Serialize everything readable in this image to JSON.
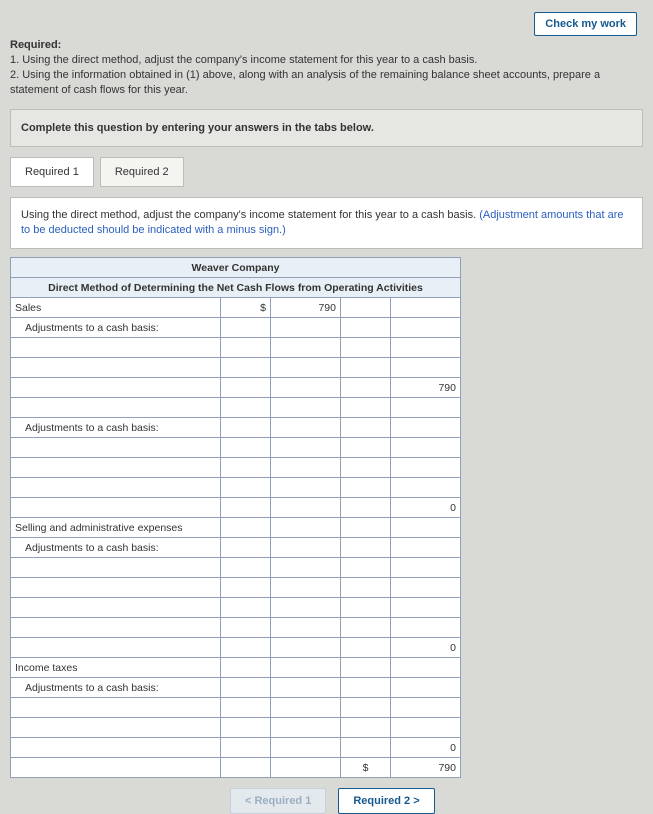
{
  "header": {
    "check_work": "Check my work"
  },
  "required": {
    "hdr": "Required:",
    "item1": "1. Using the direct method, adjust the company's income statement for this year to a cash basis.",
    "item2": "2. Using the information obtained in (1) above, along with an analysis of the remaining balance sheet accounts, prepare a statement of cash flows for this year."
  },
  "instr": "Complete this question by entering your answers in the tabs below.",
  "tabs": {
    "t1": "Required 1",
    "t2": "Required 2"
  },
  "prompt": {
    "main": "Using the direct method, adjust the company's income statement for this year to a cash basis. ",
    "note": "(Adjustment amounts that are to be deducted should be indicated with a minus sign.)"
  },
  "table": {
    "company": "Weaver Company",
    "subtitle": "Direct Method of Determining the Net Cash Flows from Operating Activities",
    "rows": {
      "sales": "Sales",
      "adj": "Adjustments to a cash basis:",
      "sga": "Selling and administrative expenses",
      "itax": "Income taxes"
    },
    "vals": {
      "cur1": "$",
      "v790a": "790",
      "v790b": "790",
      "z1": "0",
      "z2": "0",
      "z3": "0",
      "cur2": "$",
      "v790c": "790"
    }
  },
  "nav": {
    "prev": "<  Required 1",
    "next": "Required 2  >"
  }
}
